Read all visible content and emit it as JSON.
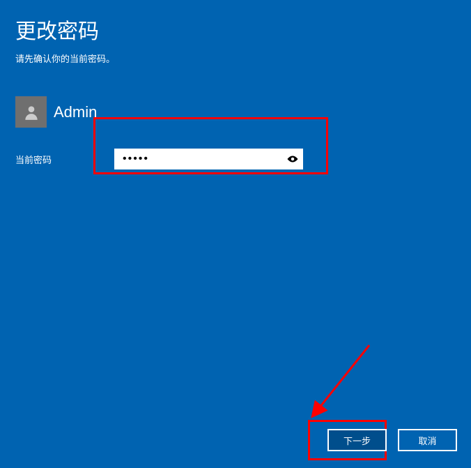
{
  "title": "更改密码",
  "subtitle": "请先确认你的当前密码。",
  "user": {
    "name": "Admin"
  },
  "form": {
    "current_password_label": "当前密码",
    "current_password_value": "•••••"
  },
  "buttons": {
    "next": "下一步",
    "cancel": "取消"
  }
}
